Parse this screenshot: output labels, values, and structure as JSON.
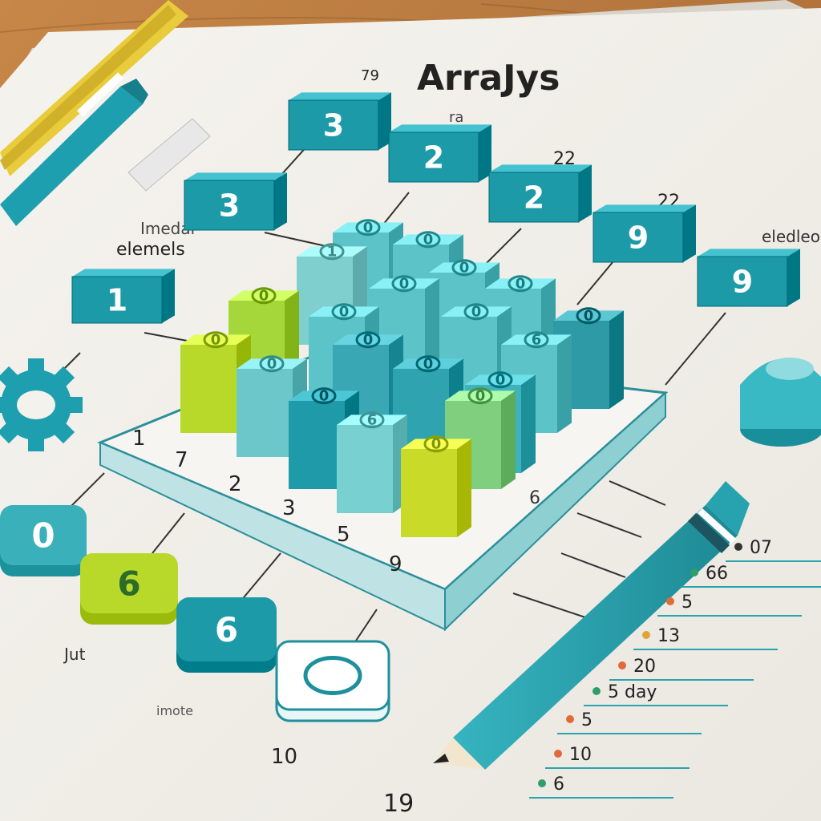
{
  "title": "ArraJys",
  "scribbles": {
    "top_left": "79",
    "under_title": "ra",
    "upper_right": "22",
    "right_middle": "22",
    "left_label_1": "Imedar",
    "left_label_2": "elemels",
    "right_label": "eledleo",
    "bottom_left": "Jut",
    "bottom_left_2": "imote",
    "bottom_center": "10",
    "bottom": "19"
  },
  "top_blocks": [
    {
      "value": "3",
      "color": "#1c9aa8"
    },
    {
      "value": "2",
      "color": "#1c9aa8"
    },
    {
      "value": "3",
      "color": "#1c9aa8"
    },
    {
      "value": "2",
      "color": "#1c9aa8"
    },
    {
      "value": "1",
      "color": "#1c9aa8"
    },
    {
      "value": "9",
      "color": "#1c9aa8"
    },
    {
      "value": "9",
      "color": "#1c9aa8"
    }
  ],
  "grid_cells": [
    {
      "value": "0",
      "color": "#5cc4c8"
    },
    {
      "value": "0",
      "color": "#5cc4c8"
    },
    {
      "value": "1",
      "color": "#7fcfcf"
    },
    {
      "value": "0",
      "color": "#5cc4c8"
    },
    {
      "value": "0",
      "color": "#5cc4c8"
    },
    {
      "value": "0",
      "color": "#a5d63a"
    },
    {
      "value": "0",
      "color": "#5cc4c8"
    },
    {
      "value": "0",
      "color": "#5cc4c8"
    },
    {
      "value": "0",
      "color": "#5cc4c8"
    },
    {
      "value": "0",
      "color": "#2e9aa6"
    },
    {
      "value": "0",
      "color": "#b8d82a"
    },
    {
      "value": "0",
      "color": "#3aa8b4"
    },
    {
      "value": "0",
      "color": "#6cc7cb"
    },
    {
      "value": "6",
      "color": "#5cc4c8"
    },
    {
      "value": "0",
      "color": "#2fa4b0"
    },
    {
      "value": "0",
      "color": "#1f9aa8"
    },
    {
      "value": "0",
      "color": "#3fb2bc"
    },
    {
      "value": "6",
      "color": "#79d0d0"
    },
    {
      "value": "0",
      "color": "#c9da28"
    },
    {
      "value": "0",
      "color": "#7fcf7f"
    }
  ],
  "axis_numbers": [
    "1",
    "7",
    "2",
    "3",
    "5",
    "9"
  ],
  "right_dots": [
    "6"
  ],
  "bottom_pucks": [
    {
      "value": "0",
      "color": "#3ab0ba"
    },
    {
      "value": "6",
      "color": "#b8d82a"
    },
    {
      "value": "6",
      "color": "#1c9aa8"
    },
    {
      "value": "0",
      "color": "#ffffff"
    }
  ],
  "side_list": [
    {
      "text": "07",
      "dot": "#333333"
    },
    {
      "text": "66",
      "dot": "#2e9e6a"
    },
    {
      "text": "5",
      "dot": "#e06a3a"
    },
    {
      "text": "13",
      "dot": "#e0a43a"
    },
    {
      "text": "20",
      "dot": "#e06a3a"
    },
    {
      "text": "5 day",
      "dot": "#2e9e6a"
    },
    {
      "text": "5",
      "dot": "#e06a3a"
    },
    {
      "text": "10",
      "dot": "#e06a3a"
    },
    {
      "text": "6",
      "dot": "#2e9e6a"
    }
  ]
}
